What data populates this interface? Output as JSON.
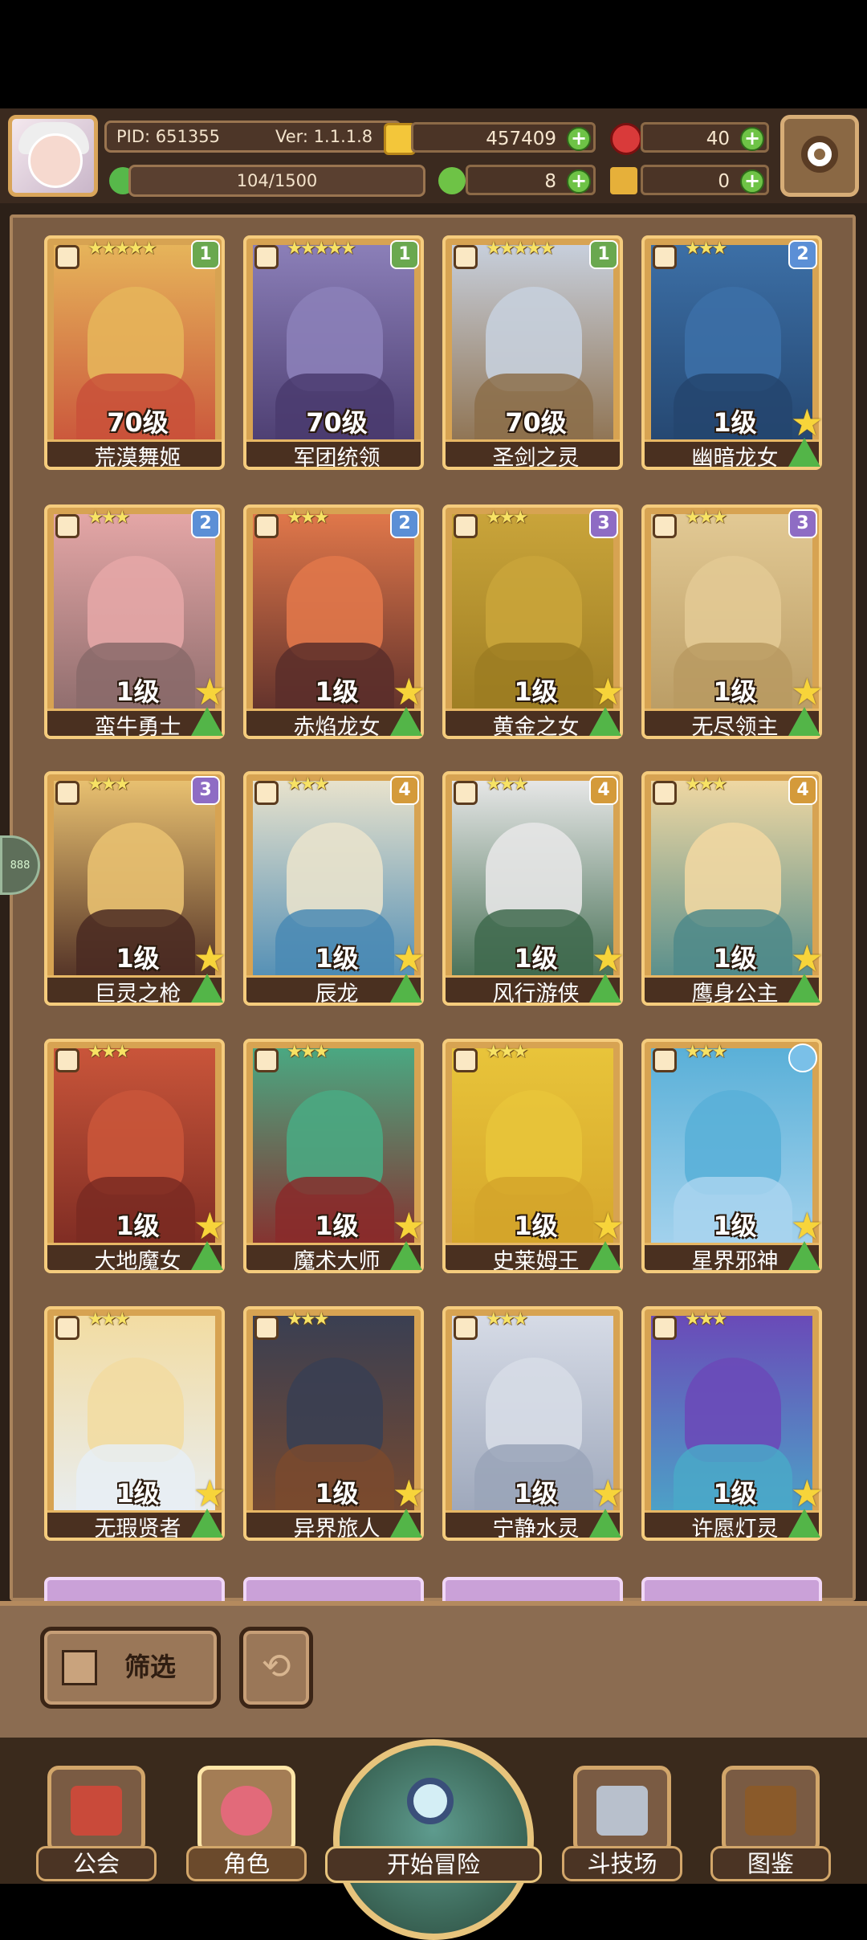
{
  "header": {
    "pid": "PID: 651355",
    "version": "Ver: 1.1.1.8",
    "gold": "457409",
    "gems": "40",
    "energy": "104/1500",
    "clover": "8",
    "keys": "0"
  },
  "side_button": "888",
  "cards": [
    {
      "name": "荒漠舞姬",
      "level": "70级",
      "stars": "★★★★★",
      "tier": "1",
      "tier_color": "#6aa84f",
      "art": "#e6b45a",
      "body": "#c9513a",
      "weapon": "wand-icon",
      "max": false
    },
    {
      "name": "军团统领",
      "level": "70级",
      "stars": "★★★★★",
      "tier": "1",
      "tier_color": "#6aa84f",
      "art": "#8b7fb8",
      "body": "#4a3b6e",
      "weapon": "sword-icon",
      "max": false
    },
    {
      "name": "圣剑之灵",
      "level": "70级",
      "stars": "★★★★★",
      "tier": "1",
      "tier_color": "#6aa84f",
      "art": "#c7cfdc",
      "body": "#8c6e4a",
      "weapon": "sword-icon",
      "max": false
    },
    {
      "name": "幽暗龙女",
      "level": "1级",
      "stars": "★★★",
      "tier": "2",
      "tier_color": "#5b8fd6",
      "art": "#3c6fa6",
      "body": "#24456e",
      "weapon": "sword-icon",
      "max": true
    },
    {
      "name": "蛮牛勇士",
      "level": "1级",
      "stars": "★★★",
      "tier": "2",
      "tier_color": "#5b8fd6",
      "art": "#e4a6a6",
      "body": "#8a6a6a",
      "weapon": "sword-icon",
      "max": true
    },
    {
      "name": "赤焰龙女",
      "level": "1级",
      "stars": "★★★",
      "tier": "2",
      "tier_color": "#5b8fd6",
      "art": "#e0774a",
      "body": "#5a2e2a",
      "weapon": "sword-icon",
      "max": true
    },
    {
      "name": "黄金之女",
      "level": "1级",
      "stars": "★★★",
      "tier": "3",
      "tier_color": "#8e6cc4",
      "art": "#c9a43a",
      "body": "#9c7c22",
      "weapon": "sword-icon",
      "max": true
    },
    {
      "name": "无尽领主",
      "level": "1级",
      "stars": "★★★",
      "tier": "3",
      "tier_color": "#8e6cc4",
      "art": "#e2c994",
      "body": "#b89a62",
      "weapon": "sword-icon",
      "max": true
    },
    {
      "name": "巨灵之枪",
      "level": "1级",
      "stars": "★★★",
      "tier": "3",
      "tier_color": "#8e6cc4",
      "art": "#e8c070",
      "body": "#4a2a22",
      "weapon": "sword-icon",
      "max": true
    },
    {
      "name": "辰龙",
      "level": "1级",
      "stars": "★★★",
      "tier": "4",
      "tier_color": "#d49a3a",
      "art": "#e8e2cc",
      "body": "#4a8ab4",
      "weapon": "sword-icon",
      "max": true
    },
    {
      "name": "风行游侠",
      "level": "1级",
      "stars": "★★★",
      "tier": "4",
      "tier_color": "#d49a3a",
      "art": "#e6e6e6",
      "body": "#3f6a4e",
      "weapon": "bow-icon",
      "max": true
    },
    {
      "name": "鹰身公主",
      "level": "1级",
      "stars": "★★★",
      "tier": "4",
      "tier_color": "#d49a3a",
      "art": "#efd7a2",
      "body": "#4f8a8a",
      "weapon": "bow-icon",
      "max": true
    },
    {
      "name": "大地魔女",
      "level": "1级",
      "stars": "★★★",
      "tier": "",
      "tier_color": "",
      "art": "#c9553a",
      "body": "#7a2a22",
      "weapon": "staff-icon",
      "max": true
    },
    {
      "name": "魔术大师",
      "level": "1级",
      "stars": "★★★",
      "tier": "",
      "tier_color": "",
      "art": "#4aa882",
      "body": "#8a2a2a",
      "weapon": "staff-icon",
      "max": true
    },
    {
      "name": "史莱姆王",
      "level": "1级",
      "stars": "★★★",
      "tier": "",
      "tier_color": "",
      "art": "#e8c43a",
      "body": "#d4a42a",
      "weapon": "staff-icon",
      "max": true
    },
    {
      "name": "星界邪神",
      "level": "1级",
      "stars": "★★★",
      "tier": "orb",
      "tier_color": "#7ac0e8",
      "art": "#5ab0d8",
      "body": "#a8d4ee",
      "weapon": "staff-icon",
      "max": true
    },
    {
      "name": "无瑕贤者",
      "level": "1级",
      "stars": "★★★",
      "tier": "",
      "tier_color": "",
      "art": "#f2dca2",
      "body": "#e8eef4",
      "weapon": "cross-icon",
      "max": true
    },
    {
      "name": "异界旅人",
      "level": "1级",
      "stars": "★★★",
      "tier": "",
      "tier_color": "",
      "art": "#3a3f52",
      "body": "#7a4a2e",
      "weapon": "cross-icon",
      "max": true
    },
    {
      "name": "宁静水灵",
      "level": "1级",
      "stars": "★★★",
      "tier": "",
      "tier_color": "",
      "art": "#d6dbe6",
      "body": "#9aa4b8",
      "weapon": "cross-icon",
      "max": true
    },
    {
      "name": "许愿灯灵",
      "level": "1级",
      "stars": "★★★",
      "tier": "",
      "tier_color": "",
      "art": "#6a4ab8",
      "body": "#4aa8c8",
      "weapon": "cross-icon",
      "max": true
    }
  ],
  "filter": {
    "label": "筛选"
  },
  "nav": {
    "guild": "公会",
    "character": "角色",
    "adventure": "开始冒险",
    "arena": "斗技场",
    "codex": "图鉴"
  }
}
